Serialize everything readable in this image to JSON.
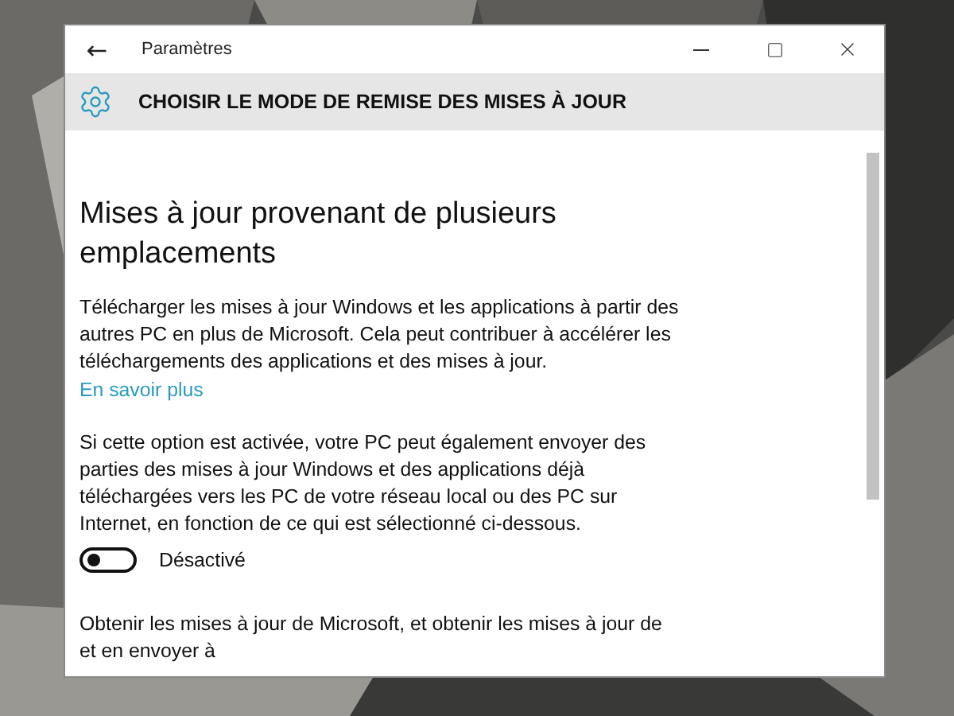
{
  "window": {
    "title": "Paramètres",
    "back": "←"
  },
  "header": {
    "title": "CHOISIR LE MODE DE REMISE DES MISES À JOUR"
  },
  "section": {
    "heading": "Mises à jour provenant de plusieurs emplacements",
    "paragraph_1": "Télécharger les mises à jour Windows et les applications à partir des autres PC en plus de Microsoft. Cela peut contribuer à accélérer les téléchargements des applications et des mises à jour.",
    "link": "En savoir plus",
    "paragraph_2": "Si cette option est activée, votre PC peut également envoyer des parties des mises à jour Windows et des applications déjà téléchargées vers les PC de votre réseau local ou des PC sur Internet, en fonction de ce qui est sélectionné ci-dessous.",
    "toggle": {
      "on": false,
      "label": "Désactivé"
    },
    "paragraph_3": "Obtenir les mises à jour de Microsoft, et obtenir les mises à jour de et en envoyer à"
  }
}
